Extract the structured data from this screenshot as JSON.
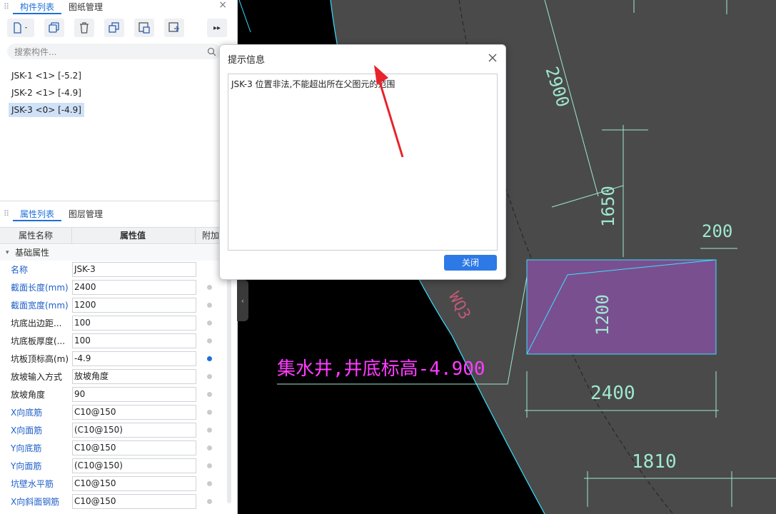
{
  "component_panel": {
    "tabs": [
      {
        "label": "构件列表",
        "active": true
      },
      {
        "label": "图纸管理",
        "active": false
      }
    ],
    "close_glyph": "×",
    "toolbar_icons": [
      "new-icon",
      "copy-icon",
      "delete-icon",
      "duplicate-icon",
      "import-icon",
      "export-icon",
      "more-icon"
    ],
    "search": {
      "placeholder": "搜索构件..."
    },
    "items": [
      {
        "label": "JSK-1  <1>  [-5.2]",
        "selected": false
      },
      {
        "label": "JSK-2  <1>  [-4.9]",
        "selected": false
      },
      {
        "label": "JSK-3  <0>  [-4.9]",
        "selected": true
      }
    ]
  },
  "property_panel": {
    "tabs": [
      {
        "label": "属性列表",
        "active": true
      },
      {
        "label": "图层管理",
        "active": false
      }
    ],
    "columns": {
      "name": "属性名称",
      "value": "属性值",
      "extra": "附加"
    },
    "group": "基础属性",
    "rows": [
      {
        "name": "名称",
        "value": "JSK-3",
        "blue": true,
        "dot": "none"
      },
      {
        "name": "截面长度(mm)",
        "value": "2400",
        "blue": true,
        "dot": "off"
      },
      {
        "name": "截面宽度(mm)",
        "value": "1200",
        "blue": true,
        "dot": "off"
      },
      {
        "name": "坑底出边距...",
        "value": "100",
        "blue": false,
        "dot": "off"
      },
      {
        "name": "坑底板厚度(...",
        "value": "100",
        "blue": false,
        "dot": "off"
      },
      {
        "name": "坑板顶标高(m)",
        "value": "-4.9",
        "blue": false,
        "dot": "on"
      },
      {
        "name": "放坡输入方式",
        "value": "放坡角度",
        "blue": false,
        "dot": "off"
      },
      {
        "name": "放坡角度",
        "value": "90",
        "blue": false,
        "dot": "off"
      },
      {
        "name": "X向底筋",
        "value": "C10@150",
        "blue": true,
        "dot": "off"
      },
      {
        "name": "X向面筋",
        "value": "(C10@150)",
        "blue": true,
        "dot": "off"
      },
      {
        "name": "Y向底筋",
        "value": "C10@150",
        "blue": true,
        "dot": "off"
      },
      {
        "name": "Y向面筋",
        "value": "(C10@150)",
        "blue": true,
        "dot": "off"
      },
      {
        "name": "坑壁水平筋",
        "value": "C10@150",
        "blue": true,
        "dot": "off"
      },
      {
        "name": "X向斜面钢筋",
        "value": "C10@150",
        "blue": true,
        "dot": "off"
      }
    ]
  },
  "dialog": {
    "title": "提示信息",
    "message": "JSK-3 位置非法,不能超出所在父图元的范围",
    "ok_label": "关闭"
  },
  "cad": {
    "labels": {
      "dim_2900": "2900",
      "dim_1650": "1650",
      "dim_200": "200",
      "dim_1200": "1200",
      "dim_2400": "2400",
      "dim_1810": "1810",
      "wall": "WQ3",
      "annotation": "集水井,井底标高-4.900"
    },
    "colors": {
      "annotation": "#ff3cff",
      "dimension": "#9fe8d0",
      "pit_fill": "#7a4f8f",
      "slab": "#4a4a4a",
      "edge": "#38e0ff",
      "arrow": "#e8232b"
    }
  }
}
